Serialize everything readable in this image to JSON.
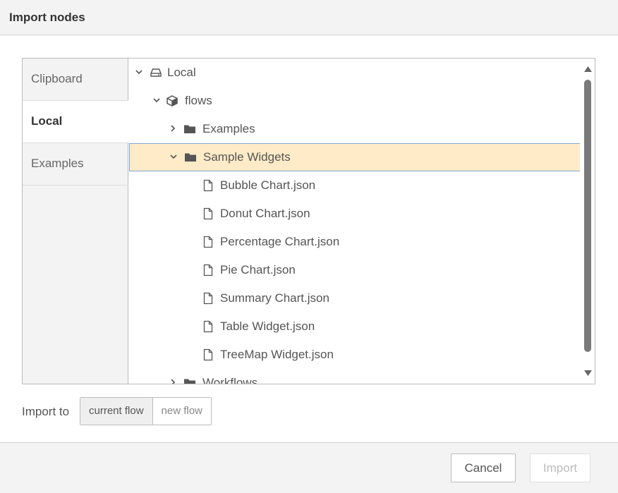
{
  "dialog": {
    "title": "Import nodes"
  },
  "tabs": [
    {
      "label": "Clipboard",
      "active": false
    },
    {
      "label": "Local",
      "active": true
    },
    {
      "label": "Examples",
      "active": false
    }
  ],
  "tree": {
    "rows": [
      {
        "label": "Local",
        "icon": "drive-icon",
        "expanded": true,
        "selected": false
      },
      {
        "label": "flows",
        "icon": "cube-icon",
        "expanded": true,
        "selected": false
      },
      {
        "label": "Examples",
        "icon": "folder-icon",
        "expanded": false,
        "selected": false
      },
      {
        "label": "Sample Widgets",
        "icon": "folder-icon",
        "expanded": true,
        "selected": true
      },
      {
        "label": "Bubble Chart.json",
        "icon": "file-icon"
      },
      {
        "label": "Donut Chart.json",
        "icon": "file-icon"
      },
      {
        "label": "Percentage Chart.json",
        "icon": "file-icon"
      },
      {
        "label": "Pie Chart.json",
        "icon": "file-icon"
      },
      {
        "label": "Summary Chart.json",
        "icon": "file-icon"
      },
      {
        "label": "Table Widget.json",
        "icon": "file-icon"
      },
      {
        "label": "TreeMap Widget.json",
        "icon": "file-icon"
      },
      {
        "label": "Workflows",
        "icon": "folder-icon",
        "expanded": false,
        "selected": false
      }
    ]
  },
  "import_to": {
    "label": "Import to",
    "options": [
      "current flow",
      "new flow"
    ],
    "selected": "current flow"
  },
  "footer": {
    "cancel_label": "Cancel",
    "import_label": "Import",
    "import_enabled": false
  },
  "colors": {
    "selected_row_bg": "#ffebc7",
    "selected_row_border": "#7fa9d8",
    "panel_bg": "#f3f3f3"
  }
}
